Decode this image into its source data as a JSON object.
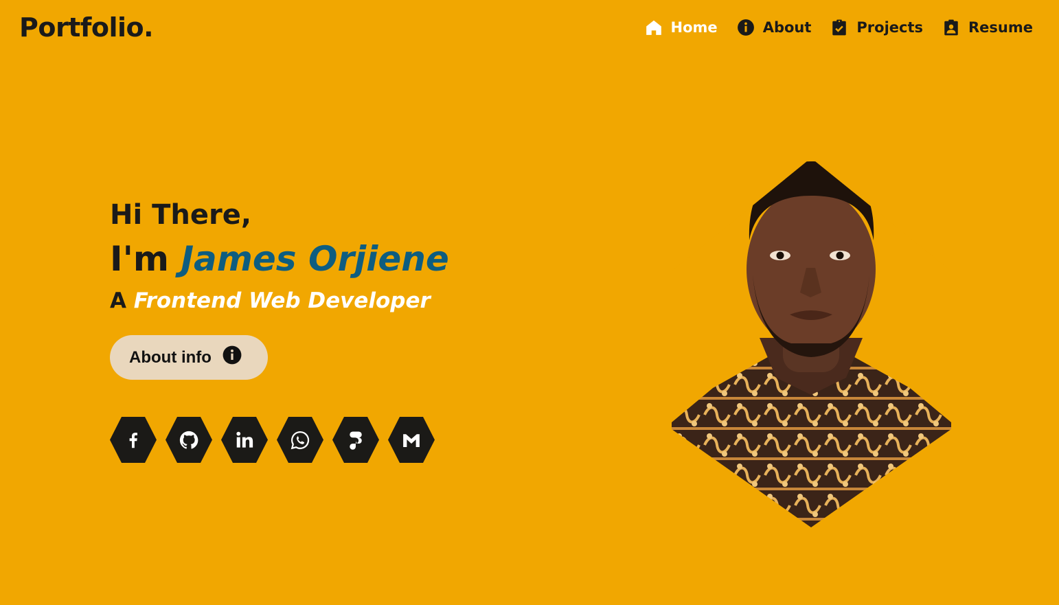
{
  "brand": {
    "logo": "Portfolio."
  },
  "nav": {
    "items": [
      {
        "label": "Home",
        "icon": "home-icon",
        "active": true
      },
      {
        "label": "About",
        "icon": "info-icon",
        "active": false
      },
      {
        "label": "Projects",
        "icon": "clipboard-check-icon",
        "active": false
      },
      {
        "label": "Resume",
        "icon": "contact-card-icon",
        "active": false
      }
    ]
  },
  "hero": {
    "greeting": "Hi There,",
    "intro_prefix": "I'm",
    "name": "James Orjiene",
    "role_prefix": "A",
    "role": "Frontend Web Developer",
    "about_button": "About info"
  },
  "socials": [
    {
      "icon": "facebook-icon"
    },
    {
      "icon": "github-icon"
    },
    {
      "icon": "linkedin-icon"
    },
    {
      "icon": "whatsapp-icon"
    },
    {
      "icon": "figma-icon"
    },
    {
      "icon": "gmail-icon"
    }
  ],
  "colors": {
    "background": "#f1a701",
    "accent_name": "#0e5d80",
    "text_dark": "#1a1a1a",
    "button_bg": "#e9d7bd",
    "hex_bg": "#1b1a17"
  }
}
